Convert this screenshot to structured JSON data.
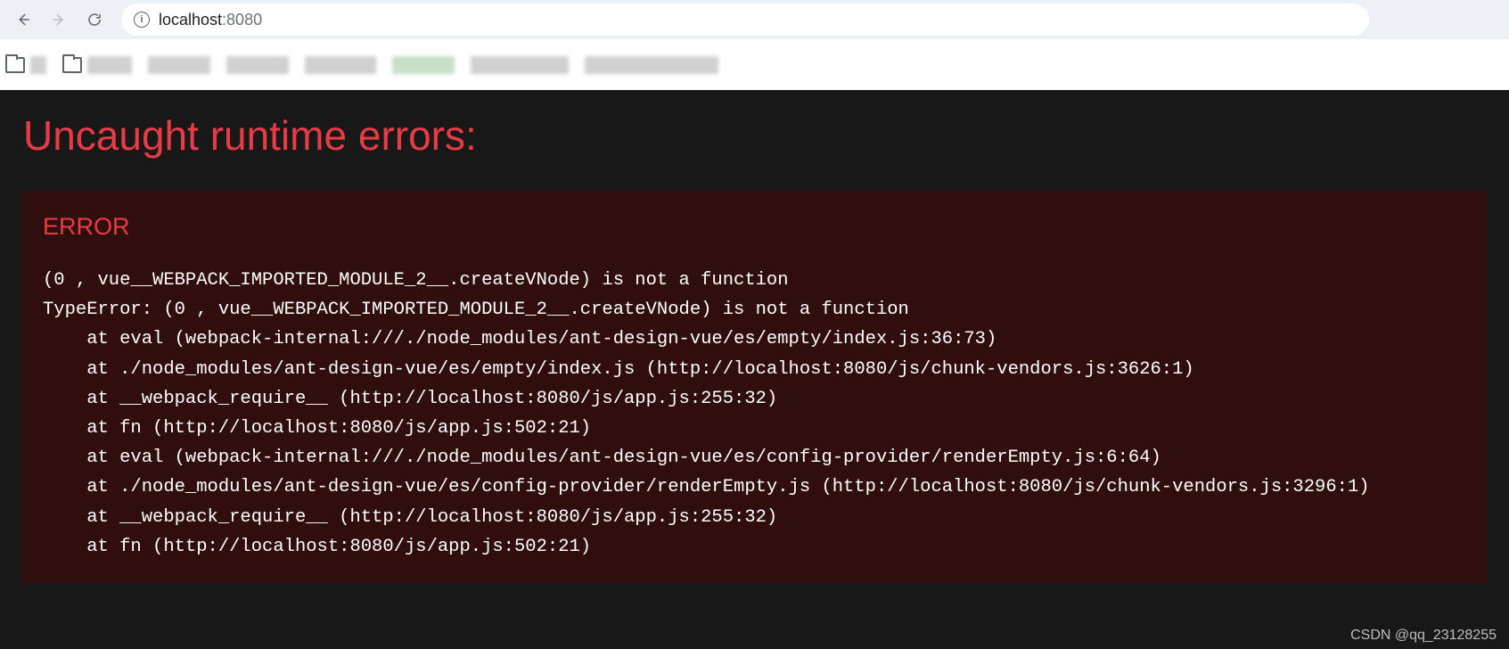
{
  "browser": {
    "url_host": "localhost",
    "url_port": ":8080"
  },
  "overlay": {
    "title": "Uncaught runtime errors:",
    "error_label": "ERROR",
    "stack": "(0 , vue__WEBPACK_IMPORTED_MODULE_2__.createVNode) is not a function\nTypeError: (0 , vue__WEBPACK_IMPORTED_MODULE_2__.createVNode) is not a function\n    at eval (webpack-internal:///./node_modules/ant-design-vue/es/empty/index.js:36:73)\n    at ./node_modules/ant-design-vue/es/empty/index.js (http://localhost:8080/js/chunk-vendors.js:3626:1)\n    at __webpack_require__ (http://localhost:8080/js/app.js:255:32)\n    at fn (http://localhost:8080/js/app.js:502:21)\n    at eval (webpack-internal:///./node_modules/ant-design-vue/es/config-provider/renderEmpty.js:6:64)\n    at ./node_modules/ant-design-vue/es/config-provider/renderEmpty.js (http://localhost:8080/js/chunk-vendors.js:3296:1)\n    at __webpack_require__ (http://localhost:8080/js/app.js:255:32)\n    at fn (http://localhost:8080/js/app.js:502:21)"
  },
  "watermark": "CSDN @qq_23128255"
}
